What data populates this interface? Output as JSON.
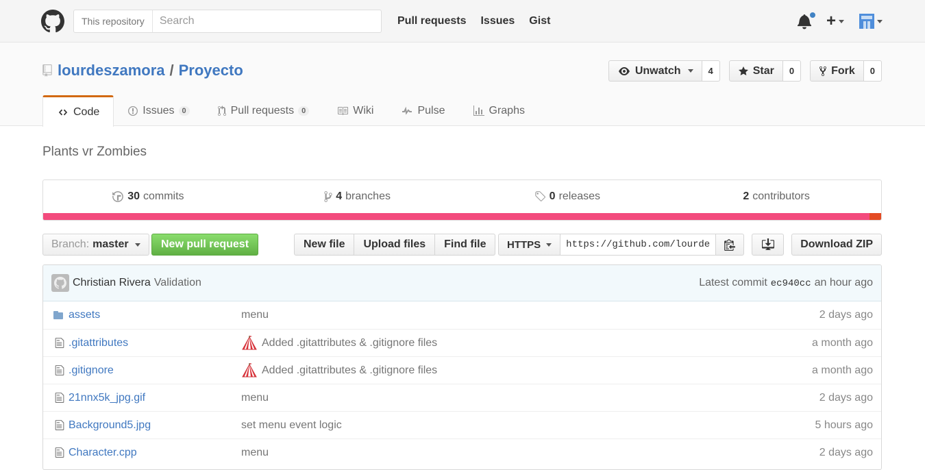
{
  "header": {
    "search_scope": "This repository",
    "search_placeholder": "Search",
    "nav": [
      "Pull requests",
      "Issues",
      "Gist"
    ],
    "notification_color": "#4183c4"
  },
  "repo": {
    "owner": "lourdeszamora",
    "name": "Proyecto",
    "description": "Plants vr Zombies",
    "actions": {
      "watch_label": "Unwatch",
      "watch_count": "4",
      "star_label": "Star",
      "star_count": "0",
      "fork_label": "Fork",
      "fork_count": "0"
    },
    "tabs": [
      {
        "label": "Code",
        "icon": "code-icon"
      },
      {
        "label": "Issues",
        "icon": "issue-opened-icon",
        "count": "0"
      },
      {
        "label": "Pull requests",
        "icon": "git-pull-request-icon",
        "count": "0"
      },
      {
        "label": "Wiki",
        "icon": "book-icon"
      },
      {
        "label": "Pulse",
        "icon": "pulse-icon"
      },
      {
        "label": "Graphs",
        "icon": "graph-icon"
      }
    ]
  },
  "summary": {
    "commits_count": "30",
    "commits_label": "commits",
    "branches_count": "4",
    "branches_label": "branches",
    "releases_count": "0",
    "releases_label": "releases",
    "contributors_count": "2",
    "contributors_label": "contributors",
    "language_colors": {
      "primary": "#f34b7d",
      "secondary": "#e44b23"
    }
  },
  "filenav": {
    "branch_prefix": "Branch:",
    "branch_name": "master",
    "new_pr": "New pull request",
    "new_file": "New file",
    "upload_files": "Upload files",
    "find_file": "Find file",
    "clone_protocol": "HTTPS",
    "clone_url": "https://github.com/lourde",
    "download_zip": "Download ZIP"
  },
  "latest_commit": {
    "author": "Christian Rivera",
    "message": "Validation",
    "prefix": "Latest commit",
    "sha": "ec940cc",
    "age": "an hour ago"
  },
  "files": [
    {
      "name": "assets",
      "type": "directory",
      "message": "menu",
      "emoji": false,
      "age": "2 days ago"
    },
    {
      "name": ".gitattributes",
      "type": "file",
      "message": "Added .gitattributes & .gitignore files",
      "emoji": true,
      "age": "a month ago"
    },
    {
      "name": ".gitignore",
      "type": "file",
      "message": "Added .gitattributes & .gitignore files",
      "emoji": true,
      "age": "a month ago"
    },
    {
      "name": "21nnx5k_jpg.gif",
      "type": "file",
      "message": "menu",
      "emoji": false,
      "age": "2 days ago"
    },
    {
      "name": "Background5.jpg",
      "type": "file",
      "message": "set menu event logic",
      "emoji": false,
      "age": "5 hours ago"
    },
    {
      "name": "Character.cpp",
      "type": "file",
      "message": "menu",
      "emoji": false,
      "age": "2 days ago"
    }
  ]
}
